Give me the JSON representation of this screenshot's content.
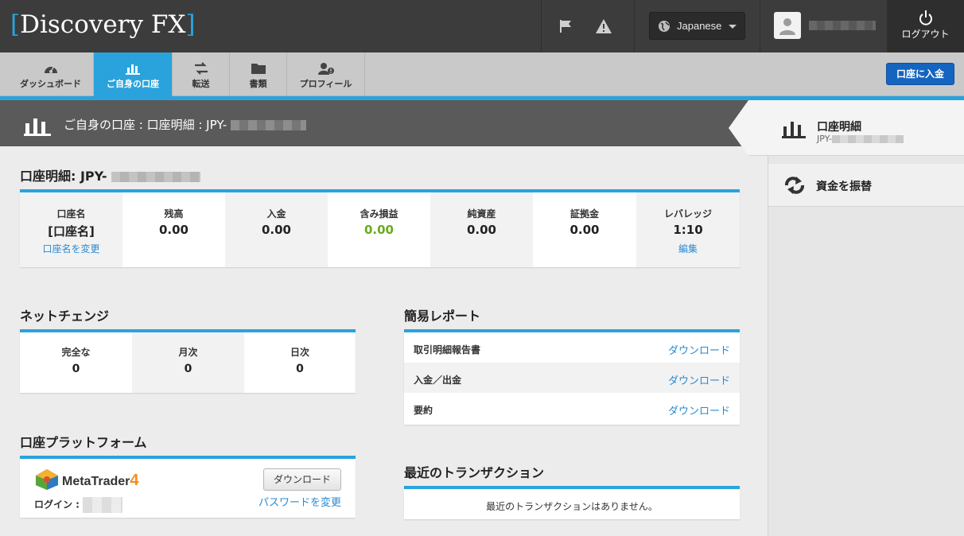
{
  "header": {
    "logo_text": "Discovery FX",
    "language": "Japanese",
    "logout_label": "ログアウト"
  },
  "nav": {
    "tabs": [
      {
        "label": "ダッシュボード",
        "icon": "dashboard-icon"
      },
      {
        "label": "ご自身の口座",
        "icon": "bar-chart-icon"
      },
      {
        "label": "転送",
        "icon": "transfer-icon"
      },
      {
        "label": "書類",
        "icon": "folder-icon"
      },
      {
        "label": "プロフィール",
        "icon": "profile-icon"
      }
    ],
    "deposit_button": "口座に入金"
  },
  "page": {
    "breadcrumb": "ご自身の口座 : 口座明細 : JPY-"
  },
  "account": {
    "title": "口座明細: JPY-",
    "cells": [
      {
        "head": "口座名",
        "value": "[口座名]",
        "link": "口座名を変更"
      },
      {
        "head": "残高",
        "value": "0.00"
      },
      {
        "head": "入金",
        "value": "0.00"
      },
      {
        "head": "含み損益",
        "value": "0.00"
      },
      {
        "head": "純資産",
        "value": "0.00"
      },
      {
        "head": "証拠金",
        "value": "0.00"
      },
      {
        "head": "レバレッジ",
        "value": "1:10",
        "link": "編集"
      }
    ]
  },
  "net_change": {
    "title": "ネットチェンジ",
    "cells": [
      {
        "head": "完全な",
        "value": "0"
      },
      {
        "head": "月次",
        "value": "0"
      },
      {
        "head": "日次",
        "value": "0"
      }
    ]
  },
  "reports": {
    "title": "簡易レポート",
    "rows": [
      {
        "label": "取引明細報告書",
        "action": "ダウンロード"
      },
      {
        "label": "入金／出金",
        "action": "ダウンロード"
      },
      {
        "label": "要約",
        "action": "ダウンロード"
      }
    ]
  },
  "platform": {
    "title": "口座プラットフォーム",
    "name": "MetaTrader",
    "version": "4",
    "download": "ダウンロード",
    "login_label": "ログイン :",
    "change_password": "パスワードを変更"
  },
  "transactions": {
    "title": "最近のトランザクション",
    "empty": "最近のトランザクションはありません。"
  },
  "sidebar": {
    "items": [
      {
        "label": "口座明細",
        "sub": "JPY-"
      },
      {
        "label": "資金を振替"
      }
    ]
  },
  "colors": {
    "accent": "#2aa3dd",
    "positive": "#6aaa1e",
    "link": "#2a8bd0",
    "header_bg": "#3c3c3c"
  }
}
